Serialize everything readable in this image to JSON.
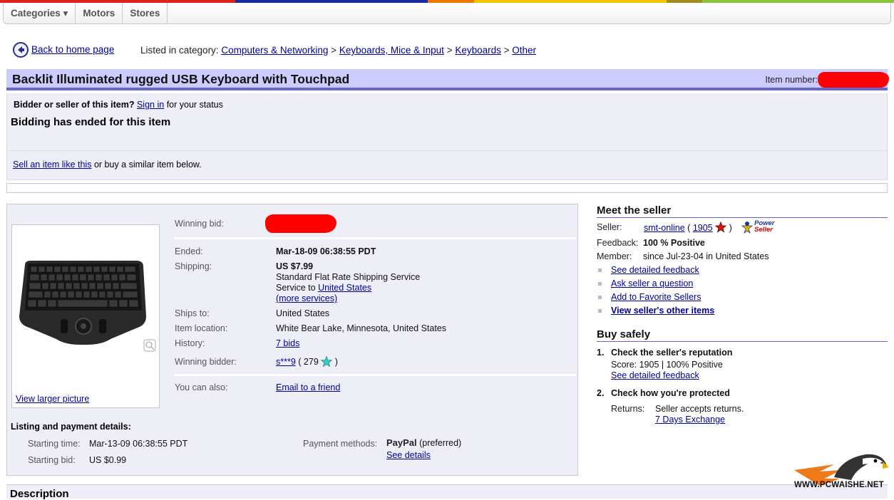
{
  "colorbar": [
    "#dd2222",
    "#dd2222",
    "#1a2aa0",
    "#1a2aa0",
    "#ee7700",
    "#f4c400",
    "#f4c400",
    "#8ac43c"
  ],
  "nav": {
    "categories": "Categories ▾",
    "motors": "Motors",
    "stores": "Stores"
  },
  "breadcrumb": {
    "back": "Back to home page",
    "prefix": "Listed in category:",
    "items": [
      "Computers & Networking",
      "Keyboards, Mice & Input",
      "Keyboards",
      "Other"
    ],
    "sep": ">"
  },
  "title": "Backlit Illuminated rugged USB Keyboard with Touchpad",
  "item_number_label": "Item number:",
  "status": {
    "question": "Bidder or seller of this item?",
    "sign_in": "Sign in",
    "suffix": "for your status",
    "ended": "Bidding has ended for this item",
    "sell_link": "Sell an item like this",
    "sell_suffix": "or buy a similar item below."
  },
  "picture": {
    "view_larger": "View larger picture"
  },
  "details": {
    "winning_bid_label": "Winning bid:",
    "ended_label": "Ended:",
    "ended_value": "Mar-18-09 06:38:55 PDT",
    "shipping_label": "Shipping:",
    "shipping_price": "US $7.99",
    "shipping_service": "Standard Flat Rate Shipping Service",
    "service_to": "Service to",
    "service_country": "United States",
    "more_services": "(more services)",
    "ships_to_label": "Ships to:",
    "ships_to_value": "United States",
    "location_label": "Item location:",
    "location_value": "White Bear Lake, Minnesota, United States",
    "history_label": "History:",
    "history_value": "7 bids",
    "bidder_label": "Winning bidder:",
    "bidder_name": "s***9",
    "bidder_score_open": "( 279",
    "bidder_score_close": ")",
    "also_label": "You can also:",
    "email_friend": "Email to a friend"
  },
  "listing": {
    "title": "Listing and payment details:",
    "start_time_label": "Starting time:",
    "start_time_value": "Mar-13-09 06:38:55 PDT",
    "start_bid_label": "Starting bid:",
    "start_bid_value": "US $0.99",
    "payment_label": "Payment methods:",
    "paypal": "PayPal",
    "preferred": "(preferred)",
    "see_details": "See details"
  },
  "seller": {
    "title": "Meet the seller",
    "seller_label": "Seller:",
    "seller_name": "smt-online",
    "paren_open": "(",
    "score": "1905",
    "paren_close": ")",
    "power_line1": "Power",
    "power_line2": "Seller",
    "feedback_label": "Feedback:",
    "feedback_value": "100 % Positive",
    "member_label": "Member:",
    "member_value": "since Jul-23-04 in United States",
    "links": [
      "See detailed feedback",
      "Ask seller a question",
      "Add to Favorite Sellers",
      "View seller's other items"
    ]
  },
  "buy_safely": {
    "title": "Buy safely",
    "step1_num": "1.",
    "step1_title": "Check the seller's reputation",
    "step1_score": "Score: 1905 | 100% Positive",
    "step1_link": "See detailed feedback",
    "step2_num": "2.",
    "step2_title": "Check how you're protected",
    "returns_label": "Returns:",
    "returns_value": "Seller accepts returns.",
    "returns_link": "7 Days Exchange"
  },
  "description_title": "Description",
  "watermark": "WWW.PCWAISHE.NET"
}
